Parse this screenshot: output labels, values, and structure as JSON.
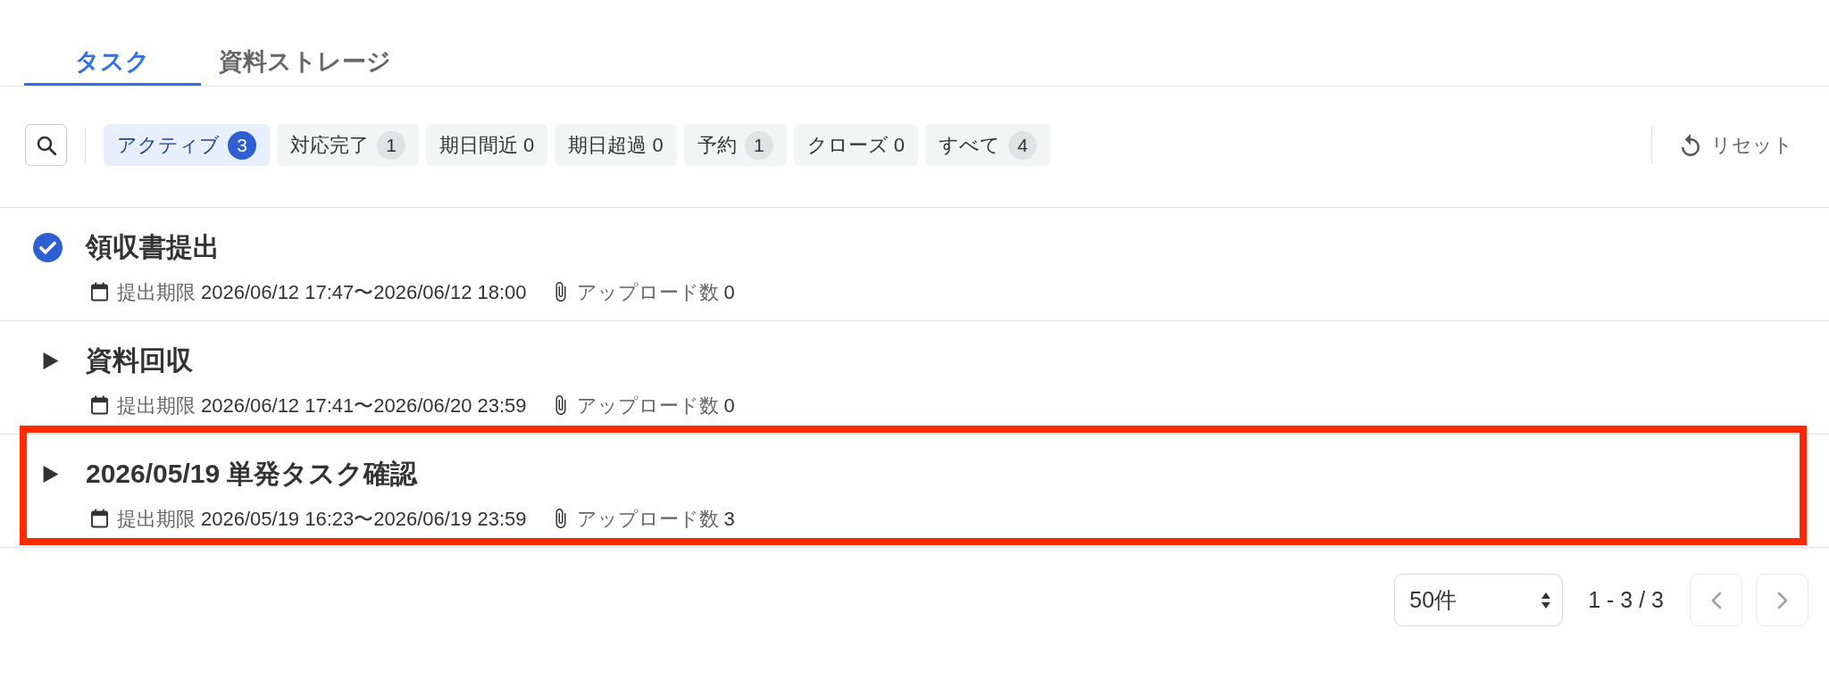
{
  "tabs": [
    {
      "label": "タスク",
      "selected": true
    },
    {
      "label": "資料ストレージ",
      "selected": false
    }
  ],
  "filters": [
    {
      "label": "アクティブ",
      "count": "3",
      "badge": true,
      "selected": true
    },
    {
      "label": "対応完了",
      "count": "1",
      "badge": true,
      "selected": false
    },
    {
      "label": "期日間近",
      "count": "0",
      "badge": false,
      "selected": false
    },
    {
      "label": "期日超過",
      "count": "0",
      "badge": false,
      "selected": false
    },
    {
      "label": "予約",
      "count": "1",
      "badge": true,
      "selected": false
    },
    {
      "label": "クローズ",
      "count": "0",
      "badge": false,
      "selected": false
    },
    {
      "label": "すべて",
      "count": "4",
      "badge": true,
      "selected": false
    }
  ],
  "reset_button": {
    "label": "リセット"
  },
  "tasks": [
    {
      "title": "領収書提出",
      "completed": true,
      "highlighted": false,
      "deadline_label": "提出期限",
      "deadline": "2026/06/12 17:47〜2026/06/12 18:00",
      "uploads_label": "アップロード数",
      "uploads": "0"
    },
    {
      "title": "資料回収",
      "completed": false,
      "highlighted": false,
      "deadline_label": "提出期限",
      "deadline": "2026/06/12 17:41〜2026/06/20 23:59",
      "uploads_label": "アップロード数",
      "uploads": "0"
    },
    {
      "title": "2026/05/19 単発タスク確認",
      "completed": false,
      "highlighted": true,
      "deadline_label": "提出期限",
      "deadline": "2026/05/19 16:23〜2026/06/19 23:59",
      "uploads_label": "アップロード数",
      "uploads": "3"
    }
  ],
  "pagination": {
    "page_size": "50件",
    "range": "1 - 3 / 3",
    "previous_button": {
      "disabled": true
    },
    "next_button": {
      "disabled": true
    }
  }
}
